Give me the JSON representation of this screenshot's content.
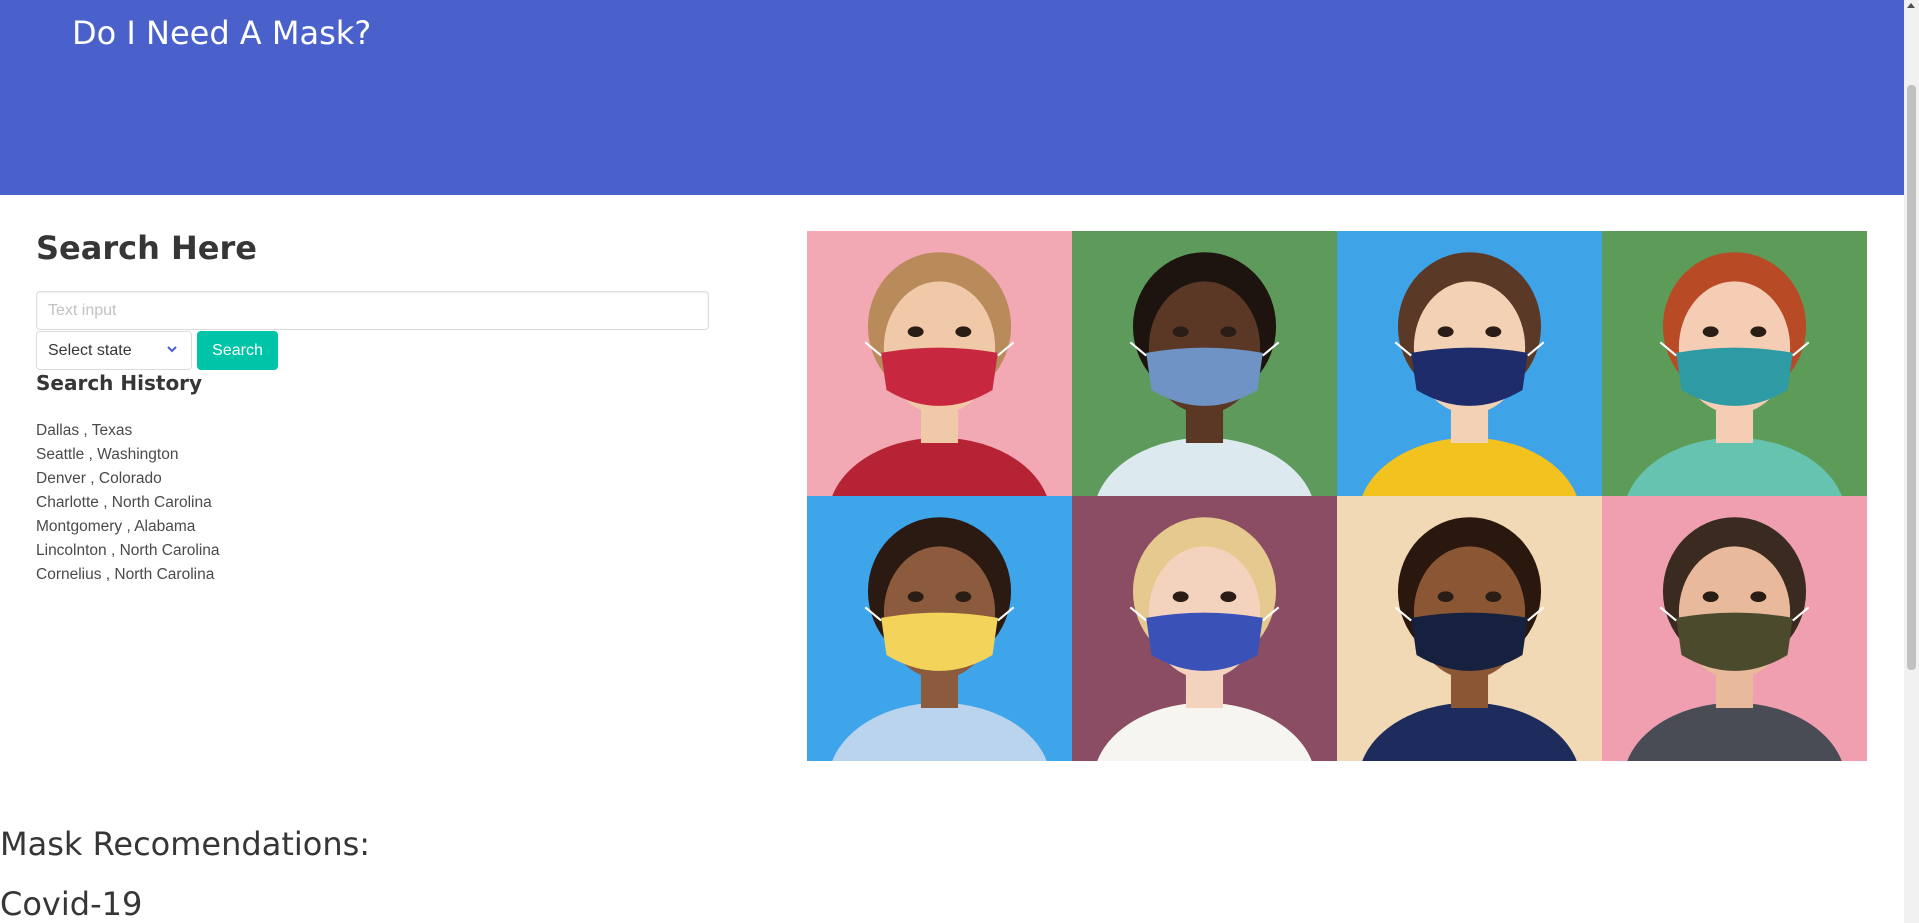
{
  "header": {
    "title": "Do I Need A Mask?",
    "color": "#4a61cb"
  },
  "search": {
    "heading": "Search Here",
    "input_placeholder": "Text input",
    "input_value": "",
    "select_value": "Select state",
    "button_label": "Search",
    "button_color": "#00c4a7"
  },
  "history": {
    "heading": "Search History",
    "items": [
      "Dallas , Texas",
      "Seattle , Washington",
      "Denver , Colorado",
      "Charlotte , North Carolina",
      "Montgomery , Alabama",
      "Lincolnton , North Carolina",
      "Cornelius , North Carolina"
    ]
  },
  "photos": [
    {
      "bg": "#f2a9b4",
      "mask": "#c8283f",
      "skin": "#f0c9a8",
      "hair": "#b98a5a",
      "shirt": "#b52335"
    },
    {
      "bg": "#5e9a5c",
      "mask": "#6f93c4",
      "skin": "#5a3825",
      "hair": "#1e140f",
      "shirt": "#dceaf0"
    },
    {
      "bg": "#3fa3e8",
      "mask": "#1f2c6b",
      "skin": "#f3d1b5",
      "hair": "#5a3a26",
      "shirt": "#f2c21f"
    },
    {
      "bg": "#5d9c58",
      "mask": "#2e9aa3",
      "skin": "#f4cdb4",
      "hair": "#b84a26",
      "shirt": "#66c3b0"
    },
    {
      "bg": "#3ea5ea",
      "mask": "#f4d35a",
      "skin": "#8c5a3c",
      "hair": "#2a1a12",
      "shirt": "#b9d4ec"
    },
    {
      "bg": "#8a4d64",
      "mask": "#3a51b8",
      "skin": "#f3d2be",
      "hair": "#e6c98e",
      "shirt": "#f7f5f0"
    },
    {
      "bg": "#f1d9b5",
      "mask": "#16213f",
      "skin": "#8a5634",
      "hair": "#2a170d",
      "shirt": "#1d2c5c"
    },
    {
      "bg": "#ef9fb0",
      "mask": "#4b4a2c",
      "skin": "#e8b99a",
      "hair": "#3a2a20",
      "shirt": "#4a4c55"
    }
  ],
  "recommendations": {
    "heading": "Mask Recomendations:"
  },
  "covid": {
    "heading": "Covid-19"
  }
}
